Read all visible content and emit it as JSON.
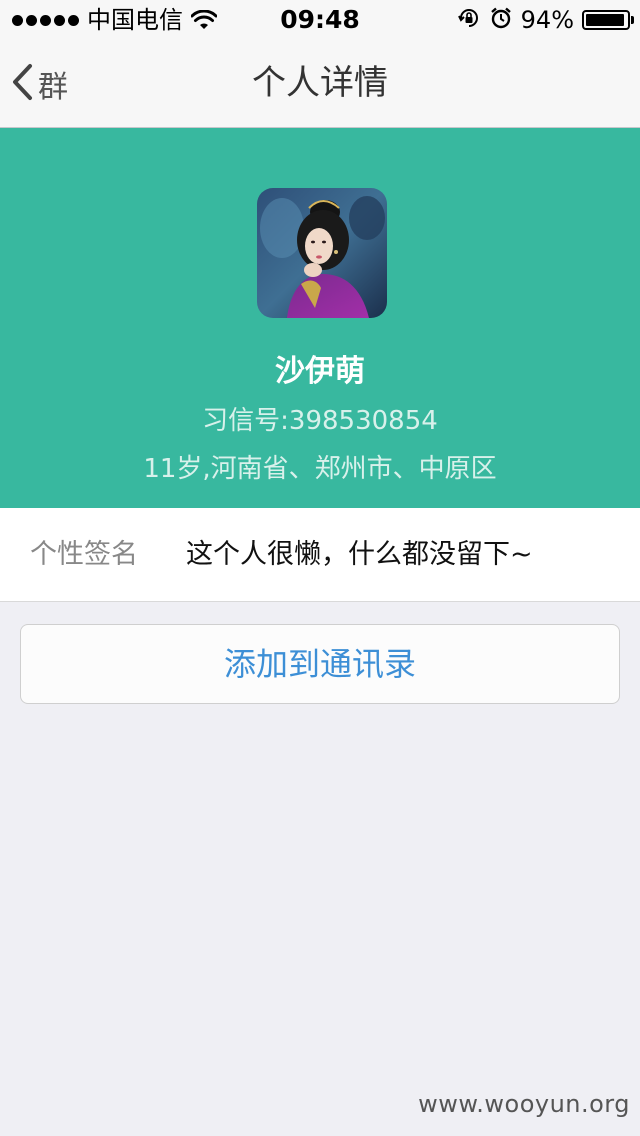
{
  "status_bar": {
    "carrier": "中国电信",
    "time": "09:48",
    "battery": "94%",
    "battery_level": 0.94,
    "icons": [
      "signal-dots-icon",
      "wifi-icon",
      "rotation-lock-icon",
      "alarm-icon",
      "battery-icon"
    ]
  },
  "nav": {
    "back_label": "群",
    "title": "个人详情"
  },
  "profile": {
    "name": "沙伊萌",
    "id": "习信号:398530854",
    "location": "11岁,河南省、郑州市、中原区",
    "header_color": "#38b89f"
  },
  "signature": {
    "label": "个性签名",
    "value": "这个人很懒，什么都没留下~"
  },
  "actions": {
    "add_contact": "添加到通讯录"
  },
  "watermark": "www.wooyun.org"
}
